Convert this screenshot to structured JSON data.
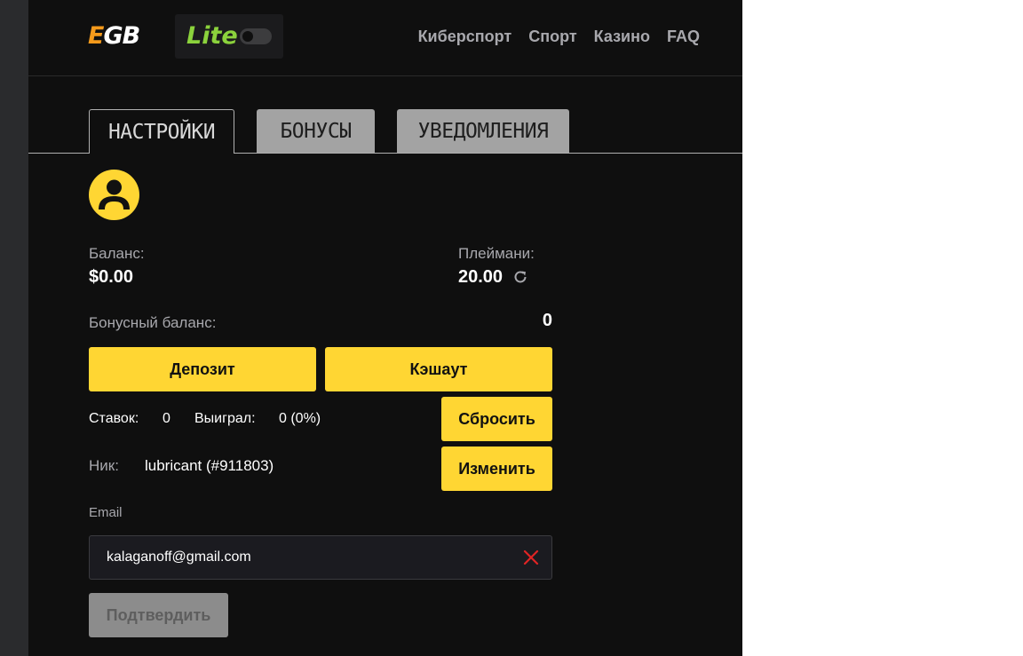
{
  "header": {
    "logo_e": "E",
    "logo_gb": "GB",
    "lite_label": "Lite",
    "nav": [
      "Киберспорт",
      "Спорт",
      "Казино",
      "FAQ"
    ]
  },
  "tabs": [
    {
      "label": "НАСТРОЙКИ",
      "active": true
    },
    {
      "label": "БОНУСЫ",
      "active": false
    },
    {
      "label": "УВЕДОМЛЕНИЯ",
      "active": false
    }
  ],
  "profile": {
    "balance_label": "Баланс:",
    "balance_value": "$0.00",
    "playmoney_label": "Плеймани:",
    "playmoney_value": "20.00",
    "bonus_label": "Бонусный баланс:",
    "bonus_value": "0",
    "deposit_button": "Депозит",
    "cashout_button": "Кэшаут",
    "bets_label": "Ставок:",
    "bets_value": "0",
    "won_label": "Выиграл:",
    "won_value": "0 (0%)",
    "reset_button": "Сбросить",
    "nick_label": "Ник:",
    "nick_value": "lubricant (#911803)",
    "change_button": "Изменить",
    "email_label": "Email",
    "email_value": "kalaganoff@gmail.com",
    "confirm_button": "Подтвердить"
  },
  "colors": {
    "accent": "#ffd633",
    "lite": "#8bd23c",
    "logo_e": "#f59a1b",
    "clear_icon": "#e02424",
    "background": "#0f0f0f"
  },
  "icons": {
    "avatar": "user-avatar-icon",
    "refresh": "refresh-icon",
    "clear": "close-icon"
  }
}
